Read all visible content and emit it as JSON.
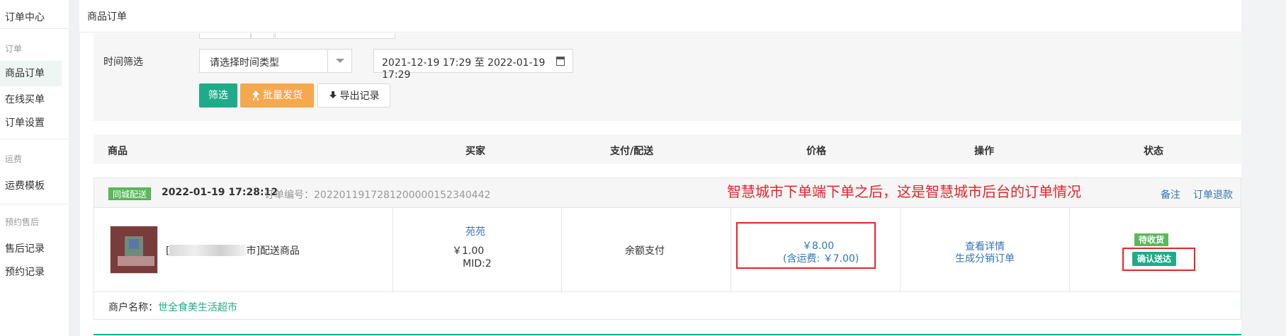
{
  "sidebar": {
    "title": "订单中心",
    "groups": [
      {
        "label": "订单",
        "items": [
          "商品订单",
          "在线买单",
          "订单设置"
        ]
      },
      {
        "label": "运费",
        "items": [
          "运费模板"
        ]
      },
      {
        "label": "预约售后",
        "items": [
          "售后记录",
          "预约记录"
        ]
      }
    ],
    "active": "商品订单"
  },
  "topbar": {
    "title": "商品订单"
  },
  "filters": {
    "time_label": "时间筛选",
    "time_type_placeholder": "请选择时间类型",
    "date_range": "2021-12-19 17:29 至 2022-01-19 17:29",
    "buttons": {
      "filter": "筛选",
      "batch_ship": "批量发货",
      "export": "导出记录"
    }
  },
  "table": {
    "headers": [
      "商品",
      "买家",
      "支付/配送",
      "价格",
      "操作",
      "状态"
    ]
  },
  "order": {
    "delivery_badge": "同城配送",
    "time": "2022-01-19 17:28:12",
    "order_no_label": "订单编号：",
    "order_no": "20220119172812000001523404​42",
    "annotation": "智慧城市下单端下单之后，这是智慧城市后台的订单情况",
    "actions": {
      "remark": "备注",
      "refund": "订单退款"
    },
    "product": {
      "name_prefix": "[",
      "name_suffix": "市]配送商品",
      "price": "￥1.00"
    },
    "buyer": {
      "name": "苑苑",
      "mid": "MID:2"
    },
    "payment": "余额支付",
    "price": {
      "total": "￥8.00",
      "shipping": "(含运费: ￥7.00)"
    },
    "operations": {
      "detail": "查看详情",
      "distribution": "生成分销订单"
    },
    "status": {
      "badge": "待收货",
      "confirm": "确认送达"
    },
    "merchant": {
      "label": "商户名称：",
      "name": "世全食美生活超市"
    }
  },
  "colors": {
    "primary": "#1fab89",
    "warning": "#f5a94f",
    "link": "#2f76b7",
    "annotation": "#e8232b",
    "badge": "#5cb85c"
  },
  "icons": [
    "upload-icon",
    "download-icon",
    "calendar-icon",
    "chevron-down-icon"
  ]
}
